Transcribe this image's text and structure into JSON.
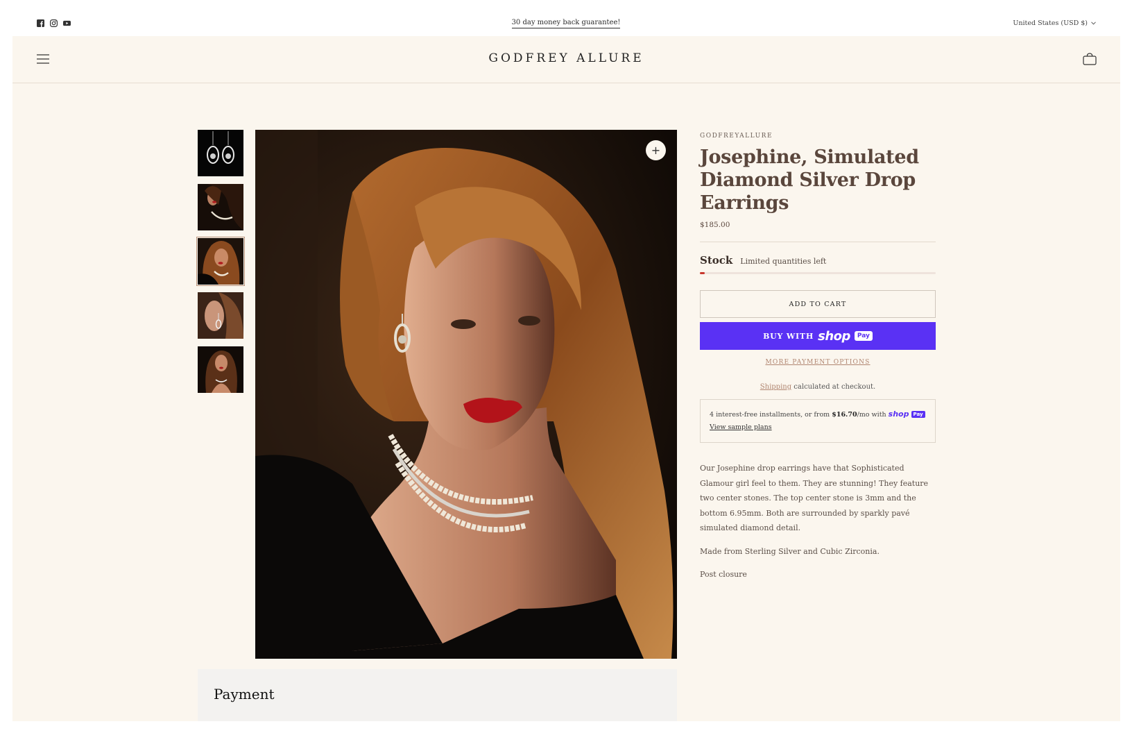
{
  "announcement": {
    "text": "30 day money back guarantee!",
    "currency": "United States (USD $)"
  },
  "social_icons": [
    "facebook-icon",
    "instagram-icon",
    "youtube-icon"
  ],
  "header": {
    "logo": "GODFREY ALLURE",
    "menu_icon": "hamburger-menu-icon",
    "cart_icon": "shopping-bag-icon"
  },
  "gallery": {
    "thumbnail_count": 5,
    "selected_index": 2,
    "zoom_label": "+"
  },
  "product": {
    "vendor": "GODFREYALLURE",
    "title": "Josephine, Simulated Diamond Silver Drop Earrings",
    "price": "$185.00",
    "stock_label": "Stock",
    "stock_text": "Limited quantities left",
    "stock_level": 0.02,
    "add_to_cart": "ADD TO CART",
    "buy_with": "BUY WITH",
    "shop_word": "shop",
    "pay_word": "Pay",
    "more_payment": "MORE PAYMENT OPTIONS",
    "shipping_link": "Shipping",
    "shipping_rest": " calculated at checkout.",
    "installments_prefix": "4 interest-free installments, or from ",
    "installments_amount": "$16.70",
    "installments_suffix": "/mo with ",
    "view_plans": "View sample plans",
    "description": [
      "Our Josephine drop earrings have that Sophisticated Glamour girl feel to them. They are stunning! They feature two center stones. The top center stone  is 3mm and the bottom 6.95mm. Both are surrounded by sparkly pavé simulated diamond detail.",
      "Made from Sterling Silver and Cubic Zirconia.",
      "Post closure"
    ]
  },
  "payment": {
    "title": "Payment"
  },
  "colors": {
    "background": "#fbf6ee",
    "accent": "#5a31f4",
    "title": "#5a463c",
    "stock_red": "#c8372d"
  }
}
